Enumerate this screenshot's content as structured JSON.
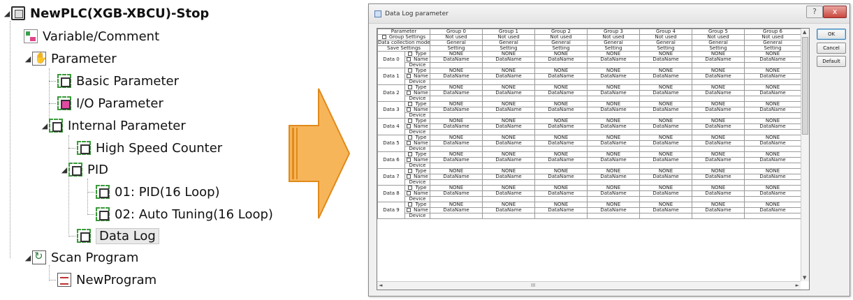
{
  "tree": {
    "items": [
      {
        "label": "NewPLC(XGB-XBCU)-Stop",
        "icon": "plc-icon",
        "expander": "◢",
        "bold": true
      },
      {
        "label": "Variable/Comment",
        "icon": "variable-comment-icon"
      },
      {
        "label": "Parameter",
        "icon": "parameter-icon",
        "expander": "◢"
      },
      {
        "label": "Basic Parameter",
        "icon": "basic-parameter-icon"
      },
      {
        "label": "I/O Parameter",
        "icon": "io-parameter-icon"
      },
      {
        "label": "Internal Parameter",
        "icon": "internal-parameter-icon",
        "expander": "◢"
      },
      {
        "label": "High Speed Counter",
        "icon": "high-speed-counter-icon"
      },
      {
        "label": "PID",
        "icon": "pid-icon",
        "expander": "◢"
      },
      {
        "label": "01: PID(16 Loop)",
        "icon": "pid-loop-icon"
      },
      {
        "label": "02: Auto Tuning(16 Loop)",
        "icon": "auto-tuning-icon"
      },
      {
        "label": "Data Log",
        "icon": "data-log-icon",
        "selected": true
      },
      {
        "label": "Scan Program",
        "icon": "scan-program-icon",
        "expander": "◢"
      },
      {
        "label": "NewProgram",
        "icon": "program-icon"
      }
    ]
  },
  "dialog": {
    "title": "Data Log parameter",
    "help_label": "?",
    "close_label": "x",
    "buttons": {
      "ok": "OK",
      "cancel": "Cancel",
      "default": "Default"
    },
    "scroll": {
      "up": "▲",
      "down": "▼",
      "left": "◄",
      "right": "►",
      "grip": "III"
    },
    "grid": {
      "header": [
        "Parameter",
        "Group 0",
        "Group 1",
        "Group 2",
        "Group 3",
        "Group 4",
        "Group 5",
        "Group 6"
      ],
      "rows_top": [
        {
          "label": "Group Settings",
          "checkbox": true,
          "values": [
            "Not used",
            "Not used",
            "Not used",
            "Not used",
            "Not used",
            "Not used",
            "Not used"
          ]
        },
        {
          "label": "Data collection mode",
          "checkbox": false,
          "values": [
            "General",
            "General",
            "General",
            "General",
            "General",
            "General",
            "General"
          ]
        },
        {
          "label": "Save Settings",
          "checkbox": false,
          "values": [
            "Setting",
            "Setting",
            "Setting",
            "Setting",
            "Setting",
            "Setting",
            "Setting"
          ]
        }
      ],
      "sub_labels": [
        "Type",
        "Name",
        "Device"
      ],
      "data_groups": [
        {
          "label": "Data 0",
          "type": "NONE",
          "name": "DataName"
        },
        {
          "label": "Data 1",
          "type": "NONE",
          "name": "DataName"
        },
        {
          "label": "Data 2",
          "type": "NONE",
          "name": "DataName"
        },
        {
          "label": "Data 3",
          "type": "NONE",
          "name": "DataName"
        },
        {
          "label": "Data 4",
          "type": "NONE",
          "name": "DataName"
        },
        {
          "label": "Data 5",
          "type": "NONE",
          "name": "DataName"
        },
        {
          "label": "Data 6",
          "type": "NONE",
          "name": "DataName"
        },
        {
          "label": "Data 7",
          "type": "NONE",
          "name": "DataName"
        },
        {
          "label": "Data 8",
          "type": "NONE",
          "name": "DataName"
        },
        {
          "label": "Data 9",
          "type": "NONE",
          "name": "DataName"
        }
      ]
    }
  },
  "colors": {
    "arrow_fill": "#f7b55a",
    "arrow_stroke": "#e08a1a",
    "close_button": "#c9463c"
  }
}
